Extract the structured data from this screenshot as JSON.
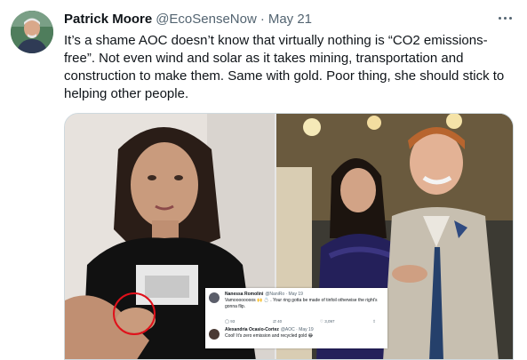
{
  "tweet": {
    "display_name": "Patrick Moore",
    "handle": "@EcoSenseNow",
    "separator": "·",
    "date": "May 21",
    "text": "It’s a shame AOC doesn’t know that virtually nothing is “CO2 emissions-free”. Not even wind and solar as it takes mining, transportation and construction to make them. Same with gold. Poor thing, she should stick to helping other people."
  },
  "icons": {
    "more": "more-horizontal-icon",
    "avatar": "profile-avatar"
  },
  "embedded_screenshot": {
    "reply": {
      "name": "Nanessa Romolini",
      "handle": "@NaniRo · May 19",
      "text": "Vamoooooooos 🙌 💍 . Your ring gotta be made of tinfoil otherwise the right's gonna flip.",
      "replies": "93",
      "retweets": "40",
      "likes": "3,097"
    },
    "quote": {
      "name": "Alexandria Ocasio-Cortez",
      "handle": "@AOC · May 19",
      "text": "Cool! It's zero emission and recycled gold 😂"
    }
  },
  "colors": {
    "text_primary": "#0f1419",
    "text_secondary": "#536471",
    "border": "#cfd9de",
    "highlight_circle": "#e0101a"
  }
}
